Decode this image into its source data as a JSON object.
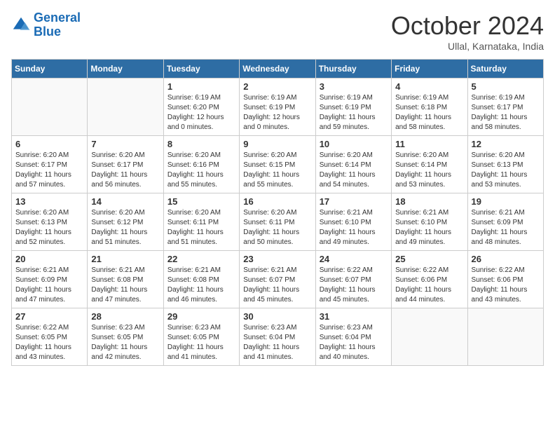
{
  "header": {
    "logo_line1": "General",
    "logo_line2": "Blue",
    "month_title": "October 2024",
    "location": "Ullal, Karnataka, India"
  },
  "weekdays": [
    "Sunday",
    "Monday",
    "Tuesday",
    "Wednesday",
    "Thursday",
    "Friday",
    "Saturday"
  ],
  "weeks": [
    [
      {
        "day": "",
        "empty": true
      },
      {
        "day": "",
        "empty": true
      },
      {
        "day": "1",
        "sunrise": "6:19 AM",
        "sunset": "6:20 PM",
        "daylight": "12 hours and 0 minutes."
      },
      {
        "day": "2",
        "sunrise": "6:19 AM",
        "sunset": "6:19 PM",
        "daylight": "12 hours and 0 minutes."
      },
      {
        "day": "3",
        "sunrise": "6:19 AM",
        "sunset": "6:19 PM",
        "daylight": "11 hours and 59 minutes."
      },
      {
        "day": "4",
        "sunrise": "6:19 AM",
        "sunset": "6:18 PM",
        "daylight": "11 hours and 58 minutes."
      },
      {
        "day": "5",
        "sunrise": "6:19 AM",
        "sunset": "6:17 PM",
        "daylight": "11 hours and 58 minutes."
      }
    ],
    [
      {
        "day": "6",
        "sunrise": "6:20 AM",
        "sunset": "6:17 PM",
        "daylight": "11 hours and 57 minutes."
      },
      {
        "day": "7",
        "sunrise": "6:20 AM",
        "sunset": "6:17 PM",
        "daylight": "11 hours and 56 minutes."
      },
      {
        "day": "8",
        "sunrise": "6:20 AM",
        "sunset": "6:16 PM",
        "daylight": "11 hours and 55 minutes."
      },
      {
        "day": "9",
        "sunrise": "6:20 AM",
        "sunset": "6:15 PM",
        "daylight": "11 hours and 55 minutes."
      },
      {
        "day": "10",
        "sunrise": "6:20 AM",
        "sunset": "6:14 PM",
        "daylight": "11 hours and 54 minutes."
      },
      {
        "day": "11",
        "sunrise": "6:20 AM",
        "sunset": "6:14 PM",
        "daylight": "11 hours and 53 minutes."
      },
      {
        "day": "12",
        "sunrise": "6:20 AM",
        "sunset": "6:13 PM",
        "daylight": "11 hours and 53 minutes."
      }
    ],
    [
      {
        "day": "13",
        "sunrise": "6:20 AM",
        "sunset": "6:13 PM",
        "daylight": "11 hours and 52 minutes."
      },
      {
        "day": "14",
        "sunrise": "6:20 AM",
        "sunset": "6:12 PM",
        "daylight": "11 hours and 51 minutes."
      },
      {
        "day": "15",
        "sunrise": "6:20 AM",
        "sunset": "6:11 PM",
        "daylight": "11 hours and 51 minutes."
      },
      {
        "day": "16",
        "sunrise": "6:20 AM",
        "sunset": "6:11 PM",
        "daylight": "11 hours and 50 minutes."
      },
      {
        "day": "17",
        "sunrise": "6:21 AM",
        "sunset": "6:10 PM",
        "daylight": "11 hours and 49 minutes."
      },
      {
        "day": "18",
        "sunrise": "6:21 AM",
        "sunset": "6:10 PM",
        "daylight": "11 hours and 49 minutes."
      },
      {
        "day": "19",
        "sunrise": "6:21 AM",
        "sunset": "6:09 PM",
        "daylight": "11 hours and 48 minutes."
      }
    ],
    [
      {
        "day": "20",
        "sunrise": "6:21 AM",
        "sunset": "6:09 PM",
        "daylight": "11 hours and 47 minutes."
      },
      {
        "day": "21",
        "sunrise": "6:21 AM",
        "sunset": "6:08 PM",
        "daylight": "11 hours and 47 minutes."
      },
      {
        "day": "22",
        "sunrise": "6:21 AM",
        "sunset": "6:08 PM",
        "daylight": "11 hours and 46 minutes."
      },
      {
        "day": "23",
        "sunrise": "6:21 AM",
        "sunset": "6:07 PM",
        "daylight": "11 hours and 45 minutes."
      },
      {
        "day": "24",
        "sunrise": "6:22 AM",
        "sunset": "6:07 PM",
        "daylight": "11 hours and 45 minutes."
      },
      {
        "day": "25",
        "sunrise": "6:22 AM",
        "sunset": "6:06 PM",
        "daylight": "11 hours and 44 minutes."
      },
      {
        "day": "26",
        "sunrise": "6:22 AM",
        "sunset": "6:06 PM",
        "daylight": "11 hours and 43 minutes."
      }
    ],
    [
      {
        "day": "27",
        "sunrise": "6:22 AM",
        "sunset": "6:05 PM",
        "daylight": "11 hours and 43 minutes."
      },
      {
        "day": "28",
        "sunrise": "6:23 AM",
        "sunset": "6:05 PM",
        "daylight": "11 hours and 42 minutes."
      },
      {
        "day": "29",
        "sunrise": "6:23 AM",
        "sunset": "6:05 PM",
        "daylight": "11 hours and 41 minutes."
      },
      {
        "day": "30",
        "sunrise": "6:23 AM",
        "sunset": "6:04 PM",
        "daylight": "11 hours and 41 minutes."
      },
      {
        "day": "31",
        "sunrise": "6:23 AM",
        "sunset": "6:04 PM",
        "daylight": "11 hours and 40 minutes."
      },
      {
        "day": "",
        "empty": true
      },
      {
        "day": "",
        "empty": true
      }
    ]
  ]
}
